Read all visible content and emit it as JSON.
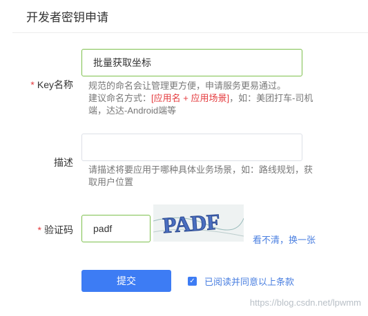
{
  "page": {
    "title": "开发者密钥申请"
  },
  "form": {
    "key_name": {
      "label": "Key名称",
      "required": "*",
      "value": "批量获取坐标",
      "help_line1": "规范的命名会让管理更方便，申请服务更易通过。",
      "help_line2_prefix": "建议命名方式：",
      "help_line2_highlight": "[应用名 + 应用场景]",
      "help_line2_suffix": "，如：美团打车-司机",
      "help_line3": "端，达达-Android端等"
    },
    "description": {
      "label": "描述",
      "value": "",
      "help_line1": "请描述将要应用于哪种具体业务场景，如：路线规划，获",
      "help_line2": "取用户位置"
    },
    "captcha": {
      "label": "验证码",
      "required": "*",
      "value": "padf",
      "image_text": "PADF",
      "refresh_link": "看不清，换一张"
    },
    "submit_label": "提交",
    "agree": {
      "checked": true,
      "check_glyph": "✓",
      "label": "已阅读并同意以上条款"
    }
  },
  "watermark": "https://blog.csdn.net/lpwmm",
  "colors": {
    "accent": "#3d7cf4",
    "required": "#e4393c",
    "focus_border": "#7cbf4b",
    "link": "#4a7fe0"
  }
}
